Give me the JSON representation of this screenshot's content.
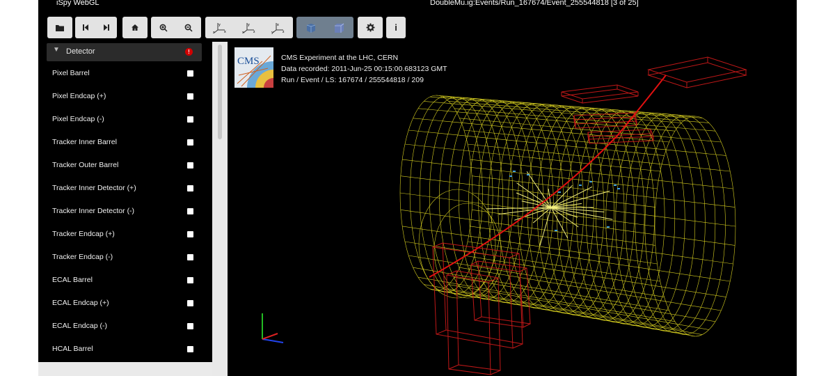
{
  "app": {
    "title": "iSpy WebGL",
    "window_title": "DoubleMu.ig:Events/Run_167674/Event_255544818 [3 of 25]"
  },
  "toolbar": {
    "buttons": [
      {
        "name": "open-file",
        "icon": "folder-icon"
      },
      {
        "name": "first-event",
        "icon": "skip-back-icon"
      },
      {
        "name": "next-event",
        "icon": "skip-forward-icon"
      },
      {
        "name": "home-view",
        "icon": "home-icon"
      },
      {
        "name": "zoom-in",
        "icon": "zoom-in-icon"
      },
      {
        "name": "zoom-out",
        "icon": "zoom-out-icon"
      },
      {
        "name": "view-yx",
        "icon": "axes-yx-icon"
      },
      {
        "name": "view-yz",
        "icon": "axes-yz-icon"
      },
      {
        "name": "view-xz",
        "icon": "axes-xz-icon"
      },
      {
        "name": "perspective",
        "icon": "cube-perspective-icon",
        "active": true
      },
      {
        "name": "orthographic",
        "icon": "cube-ortho-icon",
        "active": true
      },
      {
        "name": "settings",
        "icon": "gear-icon"
      },
      {
        "name": "info",
        "icon": "info-icon",
        "text": "i"
      }
    ]
  },
  "sidebar": {
    "section_title": "Detector",
    "items": [
      {
        "label": "Pixel Barrel",
        "checked": false
      },
      {
        "label": "Pixel Endcap (+)",
        "checked": false
      },
      {
        "label": "Pixel Endcap (-)",
        "checked": false
      },
      {
        "label": "Tracker Inner Barrel",
        "checked": false
      },
      {
        "label": "Tracker Outer Barrel",
        "checked": false
      },
      {
        "label": "Tracker Inner Detector (+)",
        "checked": false
      },
      {
        "label": "Tracker Inner Detector (-)",
        "checked": false
      },
      {
        "label": "Tracker Endcap (+)",
        "checked": false
      },
      {
        "label": "Tracker Endcap (-)",
        "checked": false
      },
      {
        "label": "ECAL Barrel",
        "checked": false
      },
      {
        "label": "ECAL Endcap (+)",
        "checked": false
      },
      {
        "label": "ECAL Endcap (-)",
        "checked": false
      },
      {
        "label": "HCAL Barrel",
        "checked": false
      }
    ]
  },
  "event_info": {
    "logo_text": "CMS",
    "experiment": "CMS Experiment at the LHC, CERN",
    "recorded": "Data recorded: 2011-Jun-25 00:15:00.683123 GMT",
    "run_event": "Run / Event / LS: 167674 / 255544818 / 209"
  },
  "colors": {
    "detector_wireframe": "#d8d020",
    "muon_chambers": "#c01818",
    "muon_track": "#e01010",
    "tracks": "#f4f080",
    "hits": "#40a0e0",
    "toolbar_button": "#e3e3e3",
    "toolbar_button_active": "#6f7f8f"
  }
}
